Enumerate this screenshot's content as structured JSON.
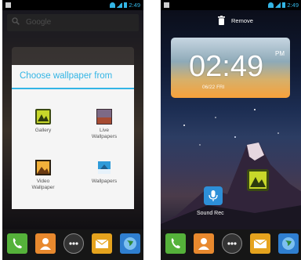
{
  "left_screen": {
    "status_time": "2:49",
    "search_placeholder": "Google",
    "dialog": {
      "title": "Choose wallpaper from",
      "options": [
        {
          "label": "Gallery",
          "icon": "gallery-icon"
        },
        {
          "label": "Live\nWallpapers",
          "icon": "live-wallpapers-icon"
        },
        {
          "label": "Video\nWallpaper",
          "icon": "video-wallpaper-icon"
        },
        {
          "label": "Wallpapers",
          "icon": "wallpapers-icon"
        }
      ]
    },
    "dock": [
      "phone-icon",
      "contacts-icon",
      "apps-drawer-icon",
      "messaging-icon",
      "browser-icon"
    ]
  },
  "right_screen": {
    "status_time": "2:49",
    "remove_label": "Remove",
    "clock": {
      "time": "02:49",
      "ampm": "PM",
      "date": "06/22 FRI"
    },
    "sound_recorder_label": "Sound Rec",
    "dock": [
      "phone-icon",
      "contacts-icon",
      "apps-drawer-icon",
      "messaging-icon",
      "browser-icon"
    ]
  },
  "colors": {
    "accent": "#33b5e5",
    "dialog_bg": "#f5f5f5"
  }
}
